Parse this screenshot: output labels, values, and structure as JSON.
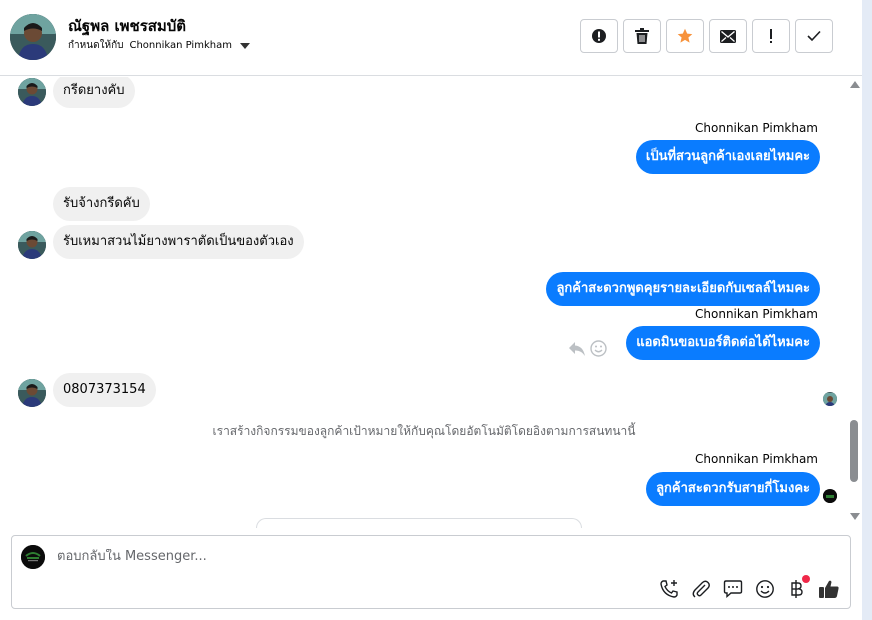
{
  "header": {
    "name": "ณัฐพล เพชรสมบัติ",
    "assign_prefix": "กำหนดให้กับ",
    "assignee": "Chonnikan Pimkham",
    "buttons": [
      {
        "name": "spam-button",
        "icon": "alert-circle-icon"
      },
      {
        "name": "delete-button",
        "icon": "trash-icon"
      },
      {
        "name": "star-button",
        "icon": "star-icon",
        "color": "#f7923b"
      },
      {
        "name": "mark-unread-button",
        "icon": "envelope-icon"
      },
      {
        "name": "follow-up-button",
        "icon": "exclamation-icon"
      },
      {
        "name": "done-button",
        "icon": "check-icon"
      }
    ]
  },
  "messages": {
    "m1": "กรีดยางคับ",
    "sender1": "Chonnikan Pimkham",
    "m2": "เป็นที่สวนลูกค้าเองเลยไหมคะ",
    "m3": "รับจ้างกรีดคับ",
    "m4": "รับเหมาสวนไม้ยางพาราตัดเป็นของตัวเอง",
    "m5": "ลูกค้าสะดวกพูดคุยรายละเอียดกับเซลล์ไหมคะ",
    "sender2": "Chonnikan Pimkham",
    "m6": "แอดมินขอเบอร์ติดต่อได้ไหมคะ",
    "m7": "0807373154",
    "system": "เราสร้างกิจกรรมของลูกค้าเป้าหมายให้กับคุณโดยอัตโนมัติโดยอิงตามการสนทนานี้",
    "sender3": "Chonnikan Pimkham",
    "m8": "ลูกค้าสะดวกรับสายกี่โมงคะ"
  },
  "composer": {
    "placeholder": "ตอบกลับใน Messenger..."
  },
  "colors": {
    "outgoing_bubble": "#0a7cff",
    "incoming_bubble": "#f0f0f0",
    "like_icon": "#333333"
  }
}
